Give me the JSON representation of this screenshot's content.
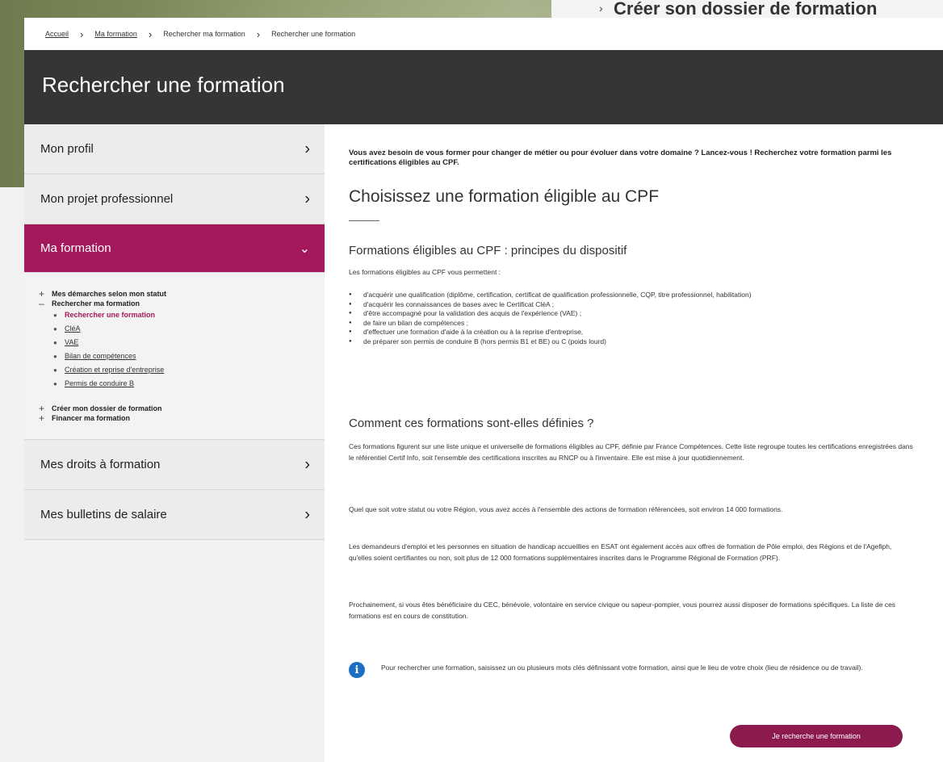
{
  "background": {
    "top_right_title": "Créer son dossier de formation"
  },
  "breadcrumb": [
    {
      "label": "Accueil"
    },
    {
      "label": "Ma formation"
    },
    {
      "label": "Rechercher ma formation"
    },
    {
      "label": "Rechercher une formation"
    }
  ],
  "page_title": "Rechercher une formation",
  "sidebar": {
    "items": [
      {
        "label": "Mon profil"
      },
      {
        "label": "Mon projet professionnel"
      },
      {
        "label": "Ma formation"
      },
      {
        "label": "Mes droits à formation"
      },
      {
        "label": "Mes bulletins de salaire"
      }
    ],
    "submenu": {
      "demarches": "Mes démarches selon mon statut",
      "rechercher": "Rechercher ma formation",
      "children": [
        "Rechercher une formation",
        "CléA",
        "VAE",
        "Bilan de compétences",
        "Création et reprise d'entreprise",
        "Permis de conduire B"
      ],
      "dossier": "Créer mon dossier de formation",
      "financer": "Financer ma formation"
    }
  },
  "main": {
    "intro": "Vous avez besoin de vous former pour changer de métier ou pour évoluer dans votre domaine ? Lancez-vous ! Recherchez votre formation parmi les certifications éligibles au CPF.",
    "h2": "Choisissez une formation éligible au CPF",
    "section1_title": "Formations éligibles au CPF : principes du dispositif",
    "section1_lead": "Les formations éligibles au CPF vous permettent :",
    "section1_bullets": [
      "d'acquérir une qualification (diplôme, certification, certificat de qualification professionnelle, CQP, titre professionnel, habilitation)",
      "d'acquérir les connaissances de bases avec le Certificat CléA ;",
      "d'être accompagné pour la validation des acquis de l'expérience (VAE) ;",
      "de faire un bilan de compétences ;",
      "d'effectuer une formation d'aide à la création ou à la reprise d'entreprise,",
      "de préparer son permis de conduire B (hors permis B1 et BE) ou C (poids lourd)"
    ],
    "section2_title": "Comment ces formations sont-elles définies ?",
    "section2_p1": "Ces formations figurent sur une liste unique et universelle de formations éligibles au CPF, définie par France Compétences. Cette liste regroupe toutes les certifications enregistrées dans le référentiel Certif Info, soit l'ensemble des certifications inscrites au RNCP ou à l'inventaire. Elle est mise à jour quotidiennement.",
    "section2_p2": "Quel que soit votre statut ou votre Région, vous avez accès à l'ensemble des actions de formation référencées, soit environ 14 000 formations.",
    "section2_p3": "Les demandeurs d'emploi et les personnes en situation de handicap accueillies en ESAT ont également accès aux offres de formation de Pôle emploi, des Régions et de l'Agefiph, qu'elles soient certifiantes ou non, soit plus de 12 000 formations supplémentaires inscrites dans le Programme Régional de Formation (PRF).",
    "section2_p4": "Prochainement, si vous êtes bénéficiaire du CEC, bénévole, volontaire en service civique ou sapeur-pompier, vous pourrez aussi disposer de formations spécifiques. La liste de ces formations est en cours de constitution.",
    "info_text": "Pour rechercher une formation, saisissez un ou plusieurs mots clés définissant votre formation, ainsi que le lieu de votre choix (lieu de résidence ou de travail).",
    "cta_label": "Je recherche une formation"
  },
  "colors": {
    "accent": "#a3195b",
    "cta": "#8c1a4e",
    "hero_bg": "#353535",
    "info_blue": "#1a6fc2"
  }
}
